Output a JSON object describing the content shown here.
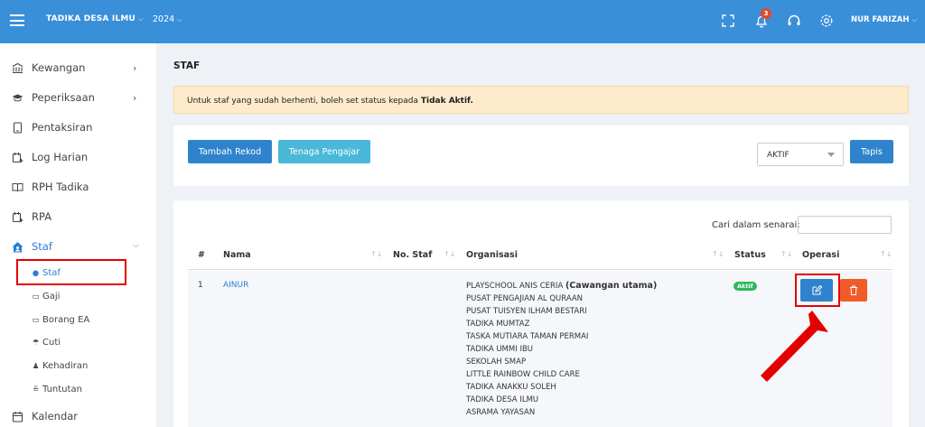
{
  "topbar": {
    "org": "TADIKA DESA ILMU",
    "year": "2024",
    "notif_count": "3",
    "user": "NUR FARIZAH"
  },
  "sidebar": {
    "items": [
      {
        "label": "Kewangan"
      },
      {
        "label": "Peperiksaan"
      },
      {
        "label": "Pentaksiran"
      },
      {
        "label": "Log Harian"
      },
      {
        "label": "RPH Tadika"
      },
      {
        "label": "RPA"
      },
      {
        "label": "Staf"
      },
      {
        "label": "Kalendar"
      }
    ],
    "subitems": [
      {
        "label": "Staf"
      },
      {
        "label": "Gaji"
      },
      {
        "label": "Borang EA"
      },
      {
        "label": "Cuti"
      },
      {
        "label": "Kehadiran"
      },
      {
        "label": "Tuntutan"
      }
    ]
  },
  "page": {
    "title": "STAF",
    "alert_text": "Untuk staf yang sudah berhenti, boleh set status kepada ",
    "alert_bold": "Tidak Aktif."
  },
  "toolbar": {
    "add_label": "Tambah Rekod",
    "teacher_label": "Tenaga Pengajar",
    "status_value": "AKTIF",
    "filter_label": "Tapis"
  },
  "table": {
    "search_label": "Cari dalam senarai:",
    "headers": [
      "#",
      "Nama",
      "No. Staf",
      "Organisasi",
      "Status",
      "Operasi"
    ],
    "sort_icon": "↑↓",
    "rows": [
      {
        "no": "1",
        "nama": "AINUR",
        "no_staf": "",
        "org_main": "PLAYSCHOOL ANIS CERIA",
        "org_main_tag": "(Cawangan utama)",
        "orgs": [
          "PUSAT PENGAJIAN AL QURAAN",
          "PUSAT TUISYEN ILHAM BESTARI",
          "TADIKA MUMTAZ",
          "TASKA MUTIARA TAMAN PERMAI",
          "TADIKA UMMI IBU",
          "SEKOLAH SMAP",
          "LITTLE RAINBOW CHILD CARE",
          "TADIKA ANAKKU SOLEH",
          "TADIKA DESA ILMU",
          "ASRAMA YAYASAN"
        ],
        "status": "Aktif"
      }
    ]
  },
  "colors": {
    "topbar": "#3a8fd9",
    "primary_button": "#2f83cc",
    "info_button": "#4ab8d8",
    "delete_button": "#f15b2a",
    "active_badge": "#2eb85c",
    "highlight": "#e40000",
    "link": "#2a7fd4"
  }
}
